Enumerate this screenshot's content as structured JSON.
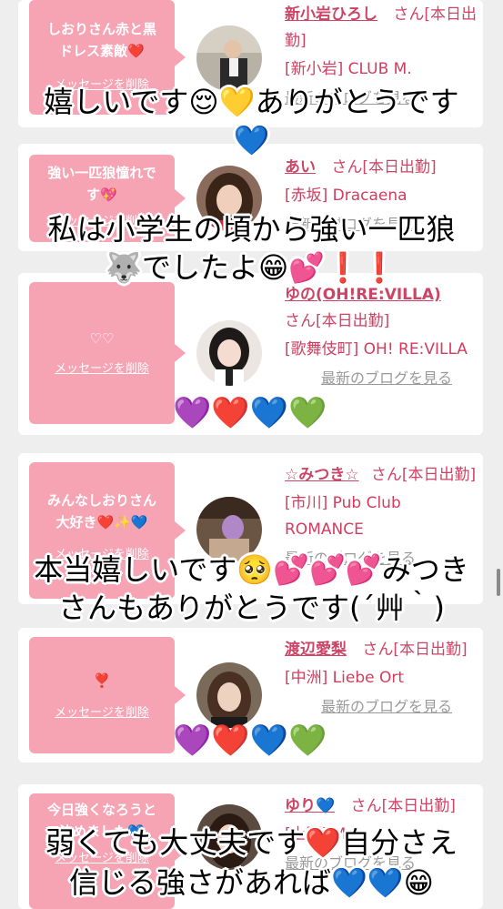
{
  "cards": [
    {
      "message": "しおりさん赤と黒ドレス素敵❤️",
      "delete_label": "メッセージを削除",
      "name": "新小岩ひろし",
      "san": "さん[本日出勤]",
      "shop": "[新小岩] CLUB M.",
      "blog": "最新のブログを見る"
    },
    {
      "message": "強い一匹狼憧れです💖",
      "delete_label": "メッセージを削除",
      "name": "あい",
      "san": "さん[本日出勤]",
      "shop": "[赤坂] Dracaena",
      "blog": "最新のブログを見る"
    },
    {
      "message": "♡♡",
      "delete_label": "メッセージを削除",
      "name": "ゆの(OH!RE:VILLA)",
      "san": "さん[本日出勤]",
      "shop": "[歌舞伎町] OH! RE:VILLA",
      "blog": "最新のブログを見る"
    },
    {
      "message": "みんなしおりさん大好き❤️✨💙",
      "delete_label": "メッセージを削除",
      "name": "☆みつき☆",
      "san": "さん[本日出勤]",
      "shop": "[市川] Pub Club ROMANCE",
      "blog": "最新のブログを見る"
    },
    {
      "message": "❣️",
      "delete_label": "メッセージを削除",
      "name": "渡辺愛梨",
      "san": "さん[本日出勤]",
      "shop": "[中洲] Liebe Ort",
      "blog": "最新のブログを見る"
    },
    {
      "message": "今日強くなろうと決めました💙",
      "delete_label": "メッセージを削除",
      "name": "ゆり💙",
      "san": "さん[本日出勤]",
      "shop": "[上野] Mar",
      "blog": "最新のブログを見る"
    }
  ],
  "overlays": {
    "o1a": "嬉しいです😌💛ありがとうです",
    "o1b": "💙",
    "o2a": "私は小学生の頃から強い一匹狼",
    "o2b": "🐺でしたよ😁💕❗❗",
    "o3": "💜❤️💙💚",
    "o4a": "本当嬉しいです🥺💕💕💕みつき",
    "o4b": "さんもありがとうです(´艸｀)",
    "o5": "💜❤️💙💚",
    "o6a": "弱くても大丈夫です❤️自分さえ",
    "o6b": "信じる強さがあれば💙💙😁"
  },
  "colors": {
    "bubble": "#f6a3b4",
    "accent": "#cc4466"
  }
}
